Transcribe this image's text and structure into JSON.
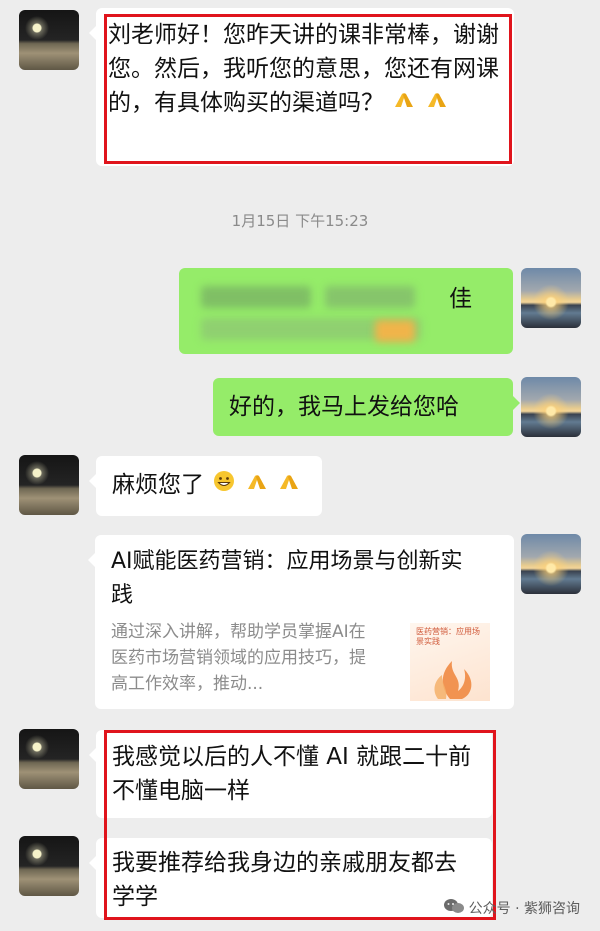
{
  "messages": [
    {
      "id": "m1",
      "sender": "left",
      "text": "刘老师好！您昨天讲的课非常棒，谢谢您。然后，我听您的意思，您还有网课的，有具体购买的渠道吗？",
      "emoji": [
        "folded-hands",
        "folded-hands"
      ]
    },
    {
      "id": "m2",
      "sender": "right",
      "text_partial_visible": "佳",
      "note": ""
    },
    {
      "id": "m3",
      "sender": "right",
      "text": "好的，我马上发给您哈"
    },
    {
      "id": "m4",
      "sender": "left",
      "text": "麻烦您了",
      "emoji": [
        "grinning-face",
        "folded-hands",
        "folded-hands"
      ]
    },
    {
      "id": "m5",
      "sender": "right",
      "type": "share-card",
      "title": "AI赋能医药营销：应用场景与创新实践",
      "description": "通过深入讲解，帮助学员掌握AI在医药市场营销领域的应用技巧，提高工作效率，推动...",
      "thumbnail_text": "医药营销：应用场景实践"
    },
    {
      "id": "m6",
      "sender": "left",
      "text": "我感觉以后的人不懂 AI 就跟二十前不懂电脑一样"
    },
    {
      "id": "m7",
      "sender": "left",
      "text": "我要推荐给我身边的亲戚朋友都去学学"
    }
  ],
  "timestamp": "1月15日 下午15:23",
  "watermark": {
    "label": "公众号 · 紫狮咨询",
    "icon": "wechat-icon"
  },
  "colors": {
    "background": "#ededed",
    "bubble_in": "#ffffff",
    "bubble_out": "#95ec69",
    "highlight": "#e0141c",
    "timestamp": "#8a8a8a"
  }
}
